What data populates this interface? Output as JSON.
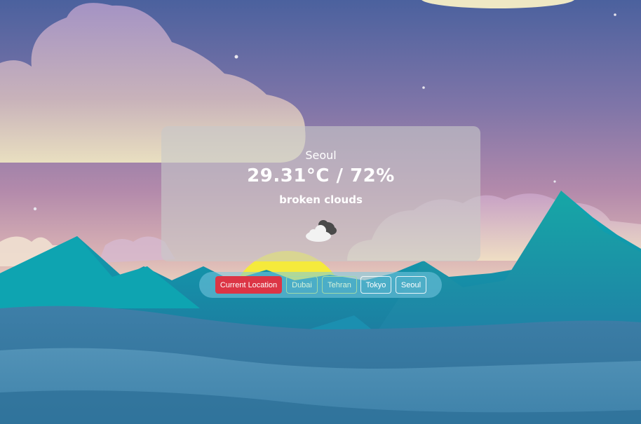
{
  "weather": {
    "city": "Seoul",
    "temperature_humidity": "29.31°C / 72%",
    "description": "broken clouds",
    "icon": "broken-clouds-icon"
  },
  "location_buttons": {
    "current_location": "Current Location",
    "cities": [
      "Dubai",
      "Tehran",
      "Tokyo",
      "Seoul"
    ]
  },
  "colors": {
    "primary_button": "#dc3545",
    "sky_top": "#4d64a0",
    "sky_mid": "#a77fa8",
    "mountain": "#0fa4b0"
  }
}
